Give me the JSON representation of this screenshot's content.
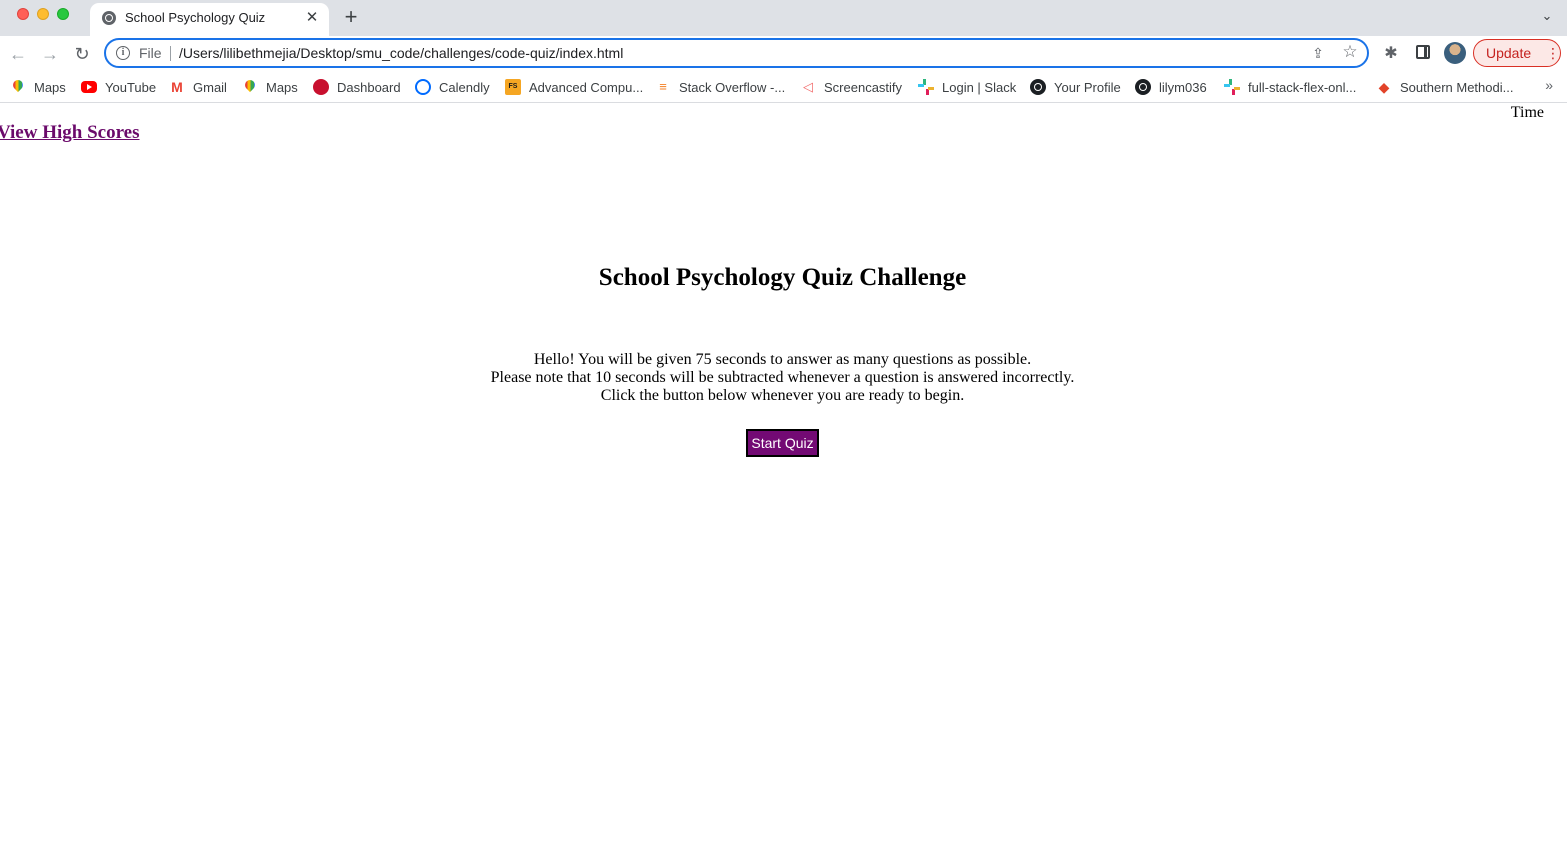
{
  "browser": {
    "tab": {
      "title": "School Psychology Quiz",
      "close": "✕"
    },
    "new_tab": "+",
    "tab_menu": "⌄",
    "nav": {
      "back": "←",
      "forward": "→",
      "reload": "↻"
    },
    "omnibox": {
      "info": "i",
      "scheme": "File",
      "url": "/Users/lilibethmejia/Desktop/smu_code/challenges/code-quiz/index.html",
      "share": "⇪",
      "star": "☆"
    },
    "extensions": "✱",
    "update": {
      "label": "Update",
      "menu": "⋮"
    },
    "bookmarks_more": "»"
  },
  "bookmarks": [
    {
      "label": "Maps",
      "icon": "maps-icon"
    },
    {
      "label": "YouTube",
      "icon": "youtube-icon"
    },
    {
      "label": "Gmail",
      "icon": "gmail-icon",
      "glyph": "M"
    },
    {
      "label": "Maps",
      "icon": "maps-icon"
    },
    {
      "label": "Dashboard",
      "icon": "dashboard-icon"
    },
    {
      "label": "Calendly",
      "icon": "calendly-icon"
    },
    {
      "label": "Advanced Compu...",
      "icon": "advanced-computing-icon",
      "glyph": "FS"
    },
    {
      "label": "Stack Overflow -...",
      "icon": "stack-overflow-icon",
      "glyph": "≡"
    },
    {
      "label": "Screencastify",
      "icon": "screencastify-icon",
      "glyph": "◁"
    },
    {
      "label": "Login | Slack",
      "icon": "slack-icon"
    },
    {
      "label": "Your Profile",
      "icon": "github-icon"
    },
    {
      "label": "lilym036",
      "icon": "github-icon"
    },
    {
      "label": "full-stack-flex-onl...",
      "icon": "slack-icon"
    },
    {
      "label": "Southern Methodi...",
      "icon": "gitlab-icon",
      "glyph": "◆"
    }
  ],
  "page": {
    "time_label": "Time",
    "high_scores_link": "View High Scores",
    "title": "School Psychology Quiz Challenge",
    "instructions": [
      "Hello! You will be given 75 seconds to answer as many questions as possible.",
      "Please note that 10 seconds will be subtracted whenever a question is answered incorrectly.",
      "Click the button below whenever you are ready to begin."
    ],
    "start_button": "Start Quiz"
  },
  "colors": {
    "accent": "#1a73e8",
    "link_visited": "#6b0a6b",
    "start_button_bg": "#730a74",
    "update_red": "#c5221f"
  }
}
